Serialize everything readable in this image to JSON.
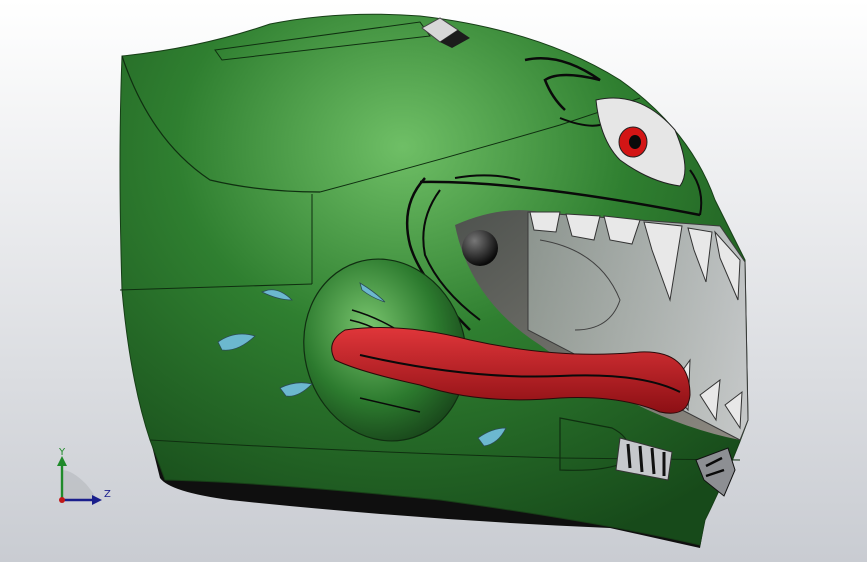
{
  "viewport": {
    "background_top": "#ffffff",
    "background_bottom": "#c9ccd2"
  },
  "model": {
    "shell_color": "#2f7a2f",
    "shell_highlight": "#5fae5a",
    "shell_shadow": "#17491a",
    "trim_color": "#0d0d0d",
    "eye_white": "#e8e8e8",
    "iris_color": "#d11414",
    "tongue_color": "#c8181e",
    "drop_color": "#6cb8cf",
    "tooth_color": "#e6e6e6"
  },
  "triad": {
    "y_label": "Y",
    "z_label": "Z",
    "y_color": "#1f8a2a",
    "z_color": "#1a1f8c",
    "x_color": "#c01818"
  }
}
